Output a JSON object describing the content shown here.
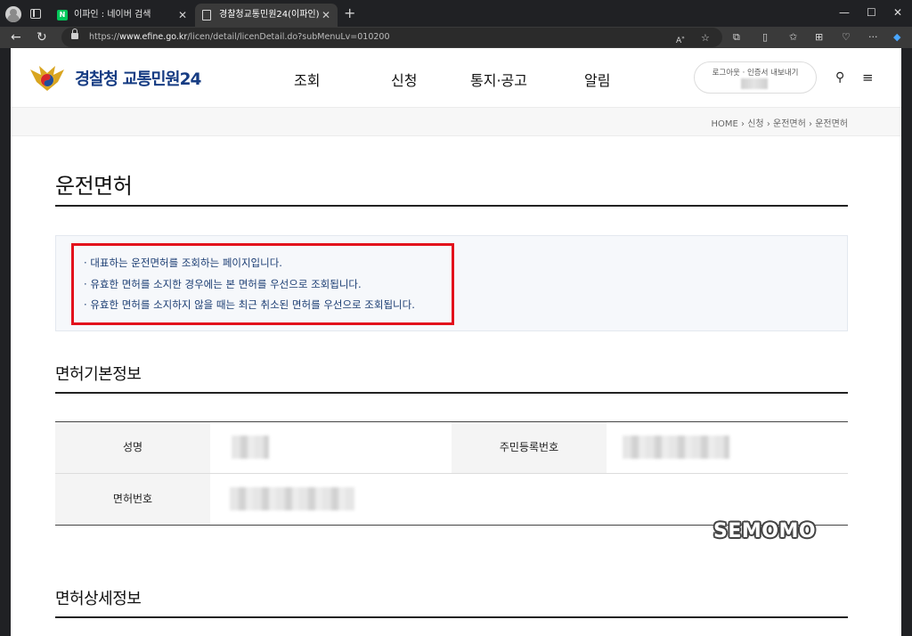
{
  "browser": {
    "tabs": [
      {
        "title": "이파인 : 네이버 검색",
        "favicon": "naver-icon",
        "active": false
      },
      {
        "title": "경찰청교통민원24(이파인)",
        "favicon": "document-icon",
        "active": true
      }
    ],
    "url_prefix": "https://",
    "url_domain": "www.efine.go.kr",
    "url_path": "/licen/detail/licenDetail.do?subMenuLv=010200"
  },
  "site": {
    "logo_text": "경찰청 교통민원24",
    "nav": [
      "조회",
      "신청",
      "통지·공고",
      "알림"
    ],
    "login": {
      "logout": "로그아웃",
      "cert": "· 인증서 내보내기"
    },
    "breadcrumb": [
      "HOME",
      "신청",
      "운전면허",
      "운전면허"
    ]
  },
  "main": {
    "page_title": "운전면허",
    "notes": [
      "대표하는 운전면허를 조회하는 페이지입니다.",
      "유효한 면허를 소지한 경우에는 본 면허를 우선으로 조회됩니다.",
      "유효한 면허를 소지하지 않을 때는 최근 취소된 면허를 우선으로 조회됩니다."
    ],
    "basic_title": "면허기본정보",
    "table": {
      "name_label": "성명",
      "rrn_label": "주민등록번호",
      "license_no_label": "면허번호"
    },
    "detail_title": "면허상세정보"
  },
  "watermark": "SEMOMO",
  "colors": {
    "highlight": "#e3111c",
    "logo_blue": "#163c83",
    "note_text": "#1b3d73"
  }
}
